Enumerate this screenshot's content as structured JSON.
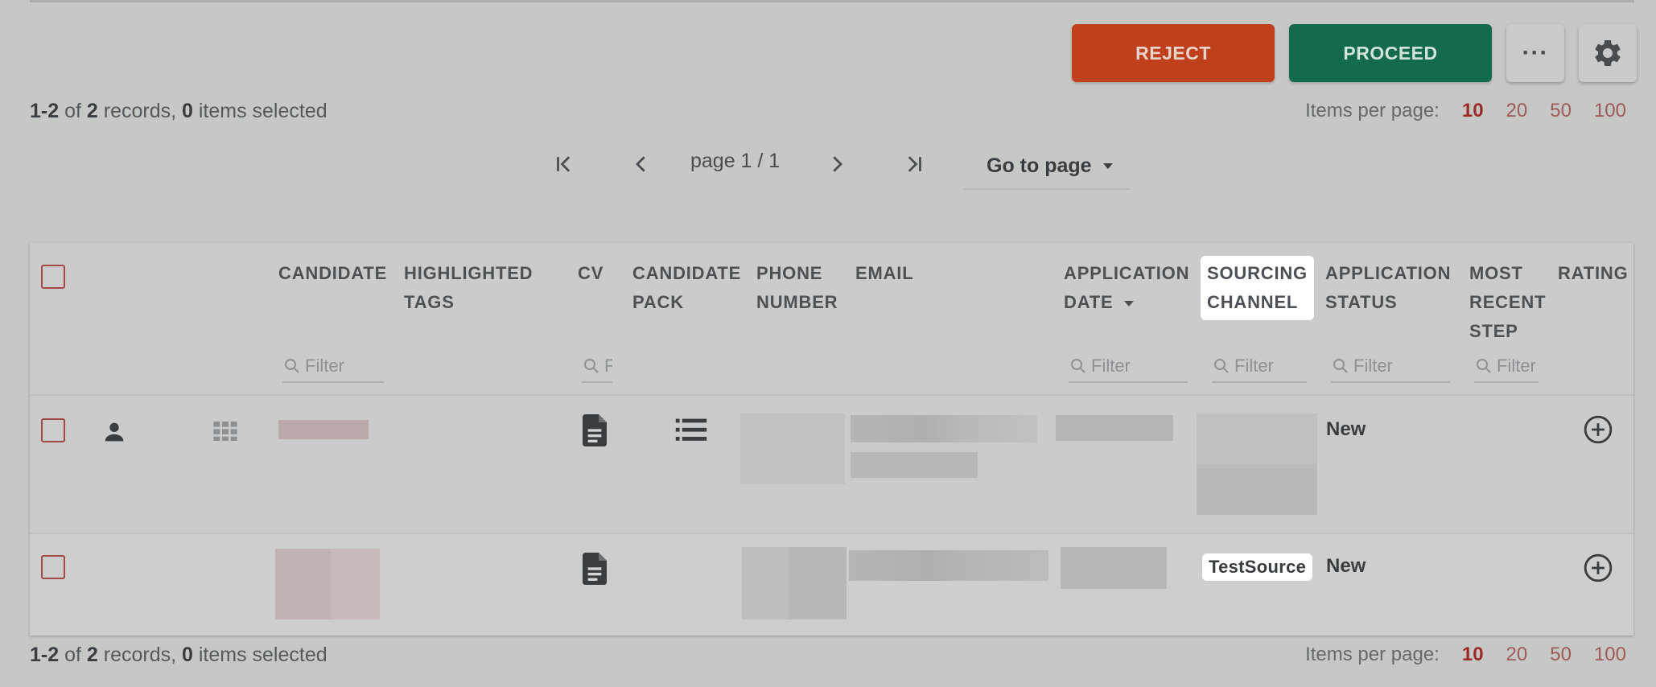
{
  "toolbar": {
    "reject_label": "REJECT",
    "proceed_label": "PROCEED",
    "more_label": "···"
  },
  "summary": {
    "range": "1-2",
    "of_text": " of ",
    "total": "2",
    "records_text": " records, ",
    "selected": "0",
    "selected_text": " items selected"
  },
  "items_per_page": {
    "label": "Items per page:",
    "options": [
      "10",
      "20",
      "50",
      "100"
    ],
    "active": "10"
  },
  "pagination": {
    "page_label": "page 1 / 1",
    "goto_label": "Go to page"
  },
  "table": {
    "columns": {
      "candidate": "CANDIDATE",
      "highlighted_tags": "HIGHLIGHTED\nTAGS",
      "cv": "CV",
      "candidate_pack": "CANDIDATE\nPACK",
      "phone_number": "PHONE\nNUMBER",
      "email": "EMAIL",
      "application_date": "APPLICATION\nDATE",
      "sourcing_channel": "SOURCING\nCHANNEL",
      "application_status": "APPLICATION\nSTATUS",
      "most_recent_step": "MOST\nRECENT\nSTEP",
      "rating": "RATING"
    },
    "filter_placeholder": "Filter",
    "rows": [
      {
        "status": "New",
        "sourcing_channel": ""
      },
      {
        "status": "New",
        "sourcing_channel": "TestSource"
      }
    ]
  },
  "icons": {
    "more": "more-horizontal-icon",
    "settings": "gear-icon",
    "first_page": "first-page-icon",
    "prev_page": "chevron-left-icon",
    "next_page": "chevron-right-icon",
    "last_page": "last-page-icon",
    "search": "search-icon",
    "person": "person-icon",
    "grid": "grid-icon",
    "document": "document-icon",
    "list": "list-icon",
    "add": "add-circle-icon"
  },
  "colors": {
    "reject": "#c0401c",
    "proceed": "#136a4c",
    "accent_red": "#9c2a2a"
  }
}
